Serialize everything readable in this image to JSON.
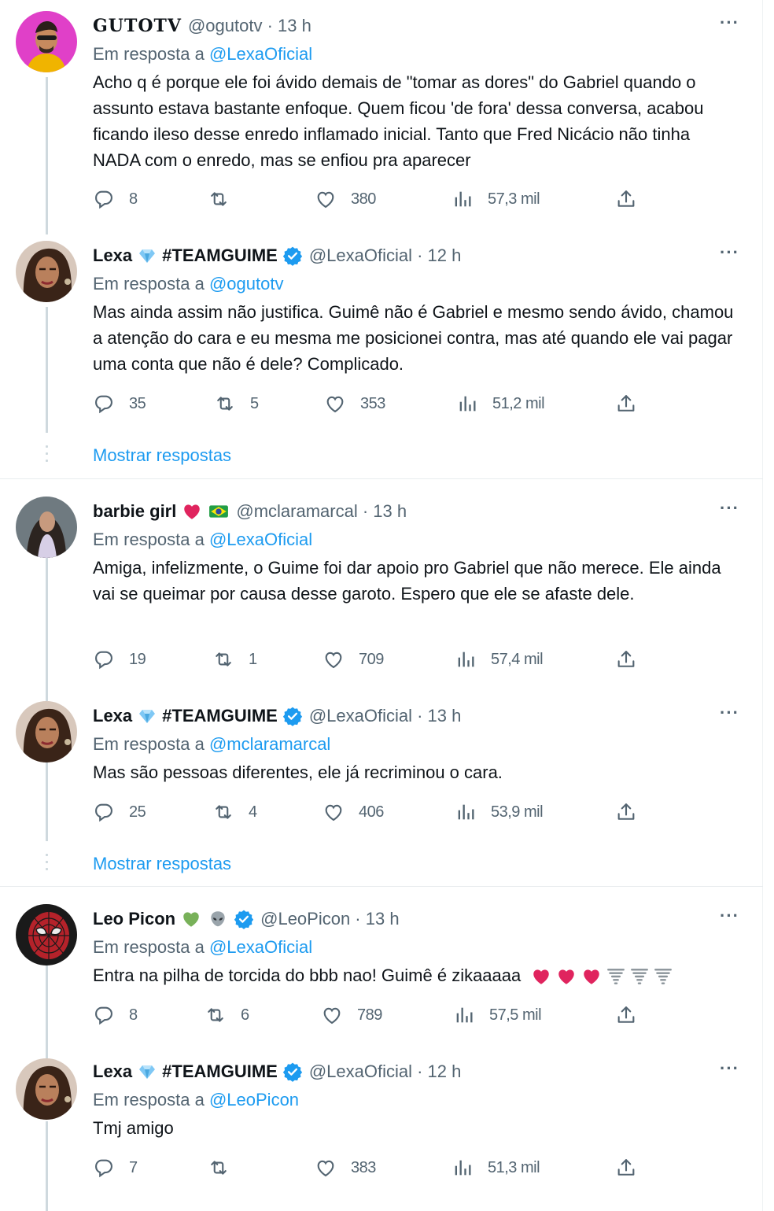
{
  "labels": {
    "replying_to": "Em resposta a",
    "show_replies": "Mostrar respostas",
    "more": "···"
  },
  "tweets": [
    {
      "name": "GUTOTV",
      "handle": "@ogutotv · 13 h",
      "reply_to": "@LexaOficial",
      "text": "Acho q é porque ele foi ávido demais de \"tomar as dores\" do Gabriel quando o assunto estava bastante enfoque. Quem ficou 'de fora' dessa conversa, acabou ficando ileso desse enredo inflamado inicial. Tanto que Fred Nicácio não tinha NADA com o enredo, mas se enfiou pra aparecer",
      "replies": "8",
      "retweets": "",
      "likes": "380",
      "views": "57,3 mil"
    },
    {
      "name": "Lexa",
      "tag": "#TEAMGUIME",
      "handle": "@LexaOficial · 12 h",
      "reply_to": "@ogutotv",
      "text": "Mas ainda assim não justifica. Guimê não é Gabriel e mesmo sendo ávido, chamou a atenção do cara e eu mesma me posicionei contra, mas até quando ele vai pagar uma conta que não é dele? Complicado.",
      "replies": "35",
      "retweets": "5",
      "likes": "353",
      "views": "51,2 mil"
    },
    {
      "name": "barbie girl",
      "handle": "@mclaramarcal · 13 h",
      "reply_to": "@LexaOficial",
      "text": "Amiga, infelizmente, o Guime foi dar apoio pro Gabriel que não merece. Ele ainda vai se queimar por causa desse garoto. Espero que ele se afaste dele.",
      "replies": "19",
      "retweets": "1",
      "likes": "709",
      "views": "57,4 mil"
    },
    {
      "name": "Lexa",
      "tag": "#TEAMGUIME",
      "handle": "@LexaOficial · 13 h",
      "reply_to": "@mclaramarcal",
      "text": "Mas são pessoas diferentes, ele já recriminou o cara.",
      "replies": "25",
      "retweets": "4",
      "likes": "406",
      "views": "53,9 mil"
    },
    {
      "name": "Leo Picon",
      "handle": "@LeoPicon · 13 h",
      "reply_to": "@LexaOficial",
      "text": "Entra na pilha de torcida do bbb nao! Guimê é zikaaaaa",
      "replies": "8",
      "retweets": "6",
      "likes": "789",
      "views": "57,5 mil"
    },
    {
      "name": "Lexa",
      "tag": "#TEAMGUIME",
      "handle": "@LexaOficial · 12 h",
      "reply_to": "@LeoPicon",
      "text": "Tmj amigo",
      "replies": "7",
      "retweets": "",
      "likes": "383",
      "views": "51,3 mil"
    }
  ],
  "colors": {
    "link": "#1d9bf0",
    "muted": "#536471",
    "verified": "#1d9bf0",
    "thread_line": "#cfd9de",
    "heart": "#e0245e"
  }
}
